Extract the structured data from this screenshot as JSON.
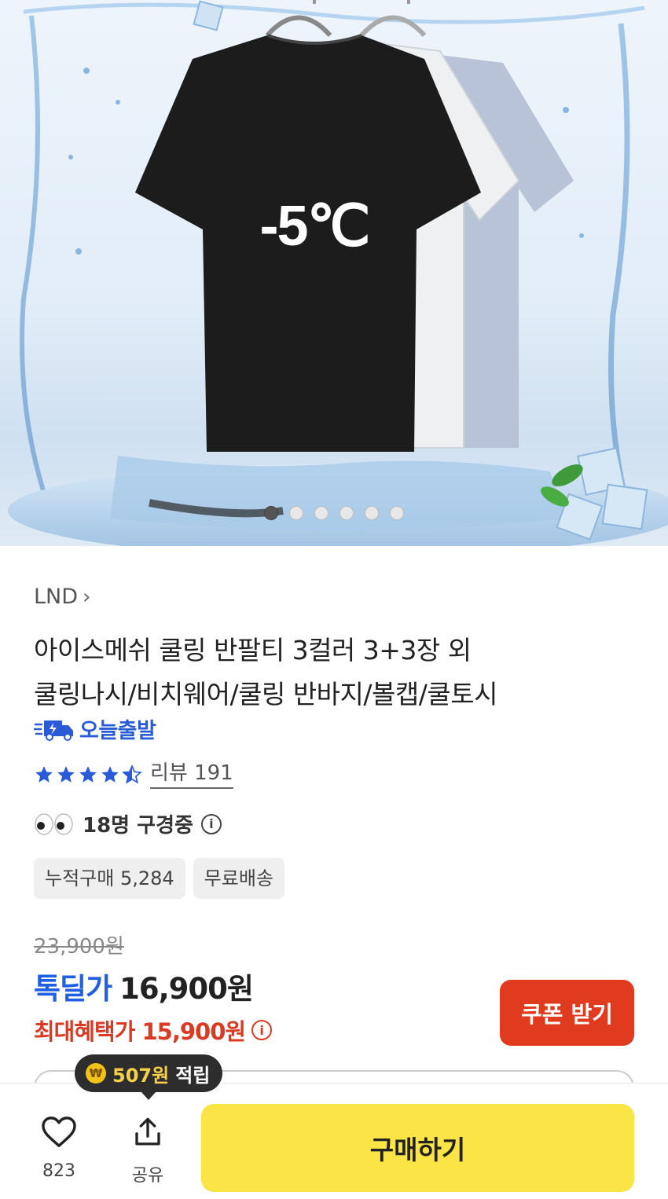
{
  "hero": {
    "shirt_print": "-5℃",
    "slide_count": 6,
    "active_slide": 1
  },
  "product": {
    "brand": "LND",
    "brand_chevron": "›",
    "title_line1": "아이스메쉬 쿨링 반팔티 3컬러 3+3장 외",
    "title_line2": "쿨링나시/비치웨어/쿨링 반바지/볼캡/쿨토시",
    "delivery_badge": "오늘출발",
    "delivery_icon": "delivery-truck-icon",
    "rating_stars": 4.5,
    "review_label": "리뷰 191",
    "viewing_label": "18명 구경중",
    "viewing_icon": "eyes-icon",
    "chips": [
      "누적구매 5,284",
      "무료배송"
    ]
  },
  "price": {
    "original": "23,900원",
    "deal_label": "톡딜가",
    "deal_value": "16,900원",
    "max_benefit": "최대혜택가 15,900원",
    "coupon_button": "쿠폰 받기"
  },
  "colors": {
    "accent_blue": "#1f5fe0",
    "accent_red": "#d83a23",
    "coupon_red": "#e03a1f",
    "buy_yellow": "#fbe445",
    "star_blue": "#2a5bd7"
  },
  "bottom_bar": {
    "tooltip_amount": "507원",
    "tooltip_text": "적립",
    "coin_symbol": "₩",
    "favorite_count": "823",
    "share_label": "공유",
    "buy_button": "구매하기"
  }
}
